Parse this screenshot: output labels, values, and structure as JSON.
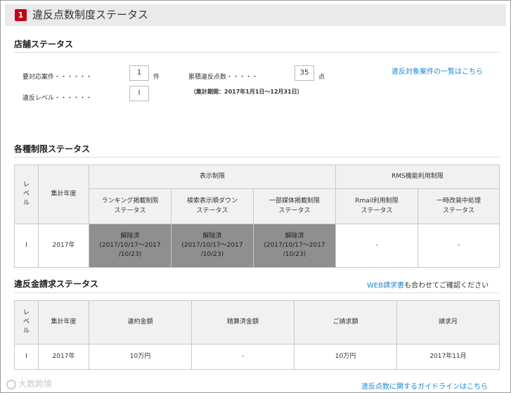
{
  "header": {
    "badge": "1",
    "title": "違反点数制度ステータス"
  },
  "store_status": {
    "title": "店舗ステータス",
    "cases_label": "要対応案件・・・・・・",
    "cases_value": "1",
    "cases_unit": "件",
    "level_label": "違反レベル・・・・・・",
    "level_value": "I",
    "points_label": "累積違反点数・・・・・",
    "points_value": "35",
    "points_unit": "点",
    "period_note": "（集計期間：2017年1月1日〜12月31日）",
    "list_link": "違反対象案件の一覧はこちら"
  },
  "restriction_status": {
    "title": "各種制限ステータス",
    "headers": {
      "level": "レベル",
      "year": "集計年度",
      "display_group": "表示制限",
      "rms_group": "RMS機能利用制限",
      "ranking": "ランキング掲載制限\nステータス",
      "search": "検索表示順ダウン\nステータス",
      "media": "一部媒体掲載制限\nステータス",
      "rmail": "Rmail利用制限\nステータス",
      "temp": "一時改装中処理\nステータス"
    },
    "row": {
      "level": "I",
      "year": "2017年",
      "ranking": "解除済\n(2017/10/17〜2017\n/10/23)",
      "search": "解除済\n(2017/10/17〜2017\n/10/23)",
      "media": "解除済\n(2017/10/17〜2017\n/10/23)",
      "rmail": "-",
      "temp": "-"
    }
  },
  "penalty_status": {
    "title": "違反金請求ステータス",
    "link_part": "WEB請求書",
    "link_suffix": "も合わせてご確認ください",
    "headers": {
      "level": "レベル",
      "year": "集計年度",
      "amount": "違約金額",
      "settlement": "精算済金額",
      "billed": "ご請求額",
      "month": "請求月"
    },
    "row": {
      "level": "I",
      "year": "2017年",
      "amount": "10万円",
      "settlement": "-",
      "billed": "10万円",
      "month": "2017年11月"
    }
  },
  "footer": {
    "guideline_link": "違反点数に関するガイドラインはこちら",
    "watermark": "大数跨境"
  },
  "colors": {
    "accent": "#c40018",
    "link": "#1a8ad4",
    "released_cell": "#8f8f8f"
  }
}
